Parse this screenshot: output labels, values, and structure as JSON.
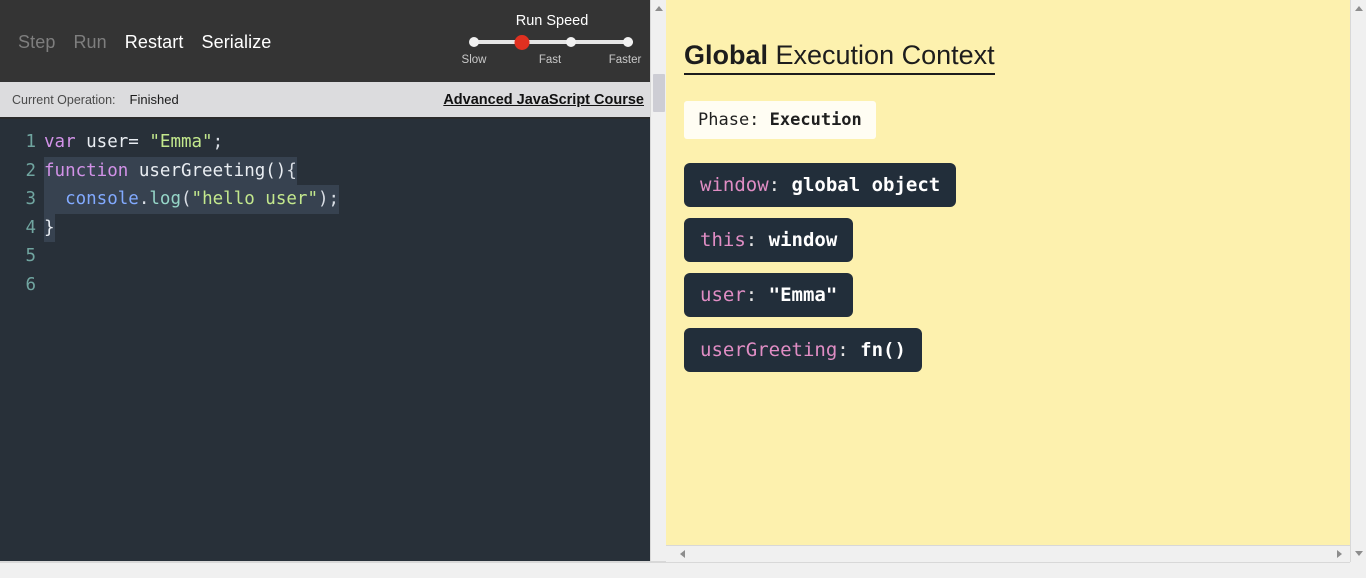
{
  "toolbar": {
    "buttons": [
      {
        "label": "Step",
        "enabled": false
      },
      {
        "label": "Run",
        "enabled": false
      },
      {
        "label": "Restart",
        "enabled": true
      },
      {
        "label": "Serialize",
        "enabled": true
      }
    ],
    "speed": {
      "title": "Run Speed",
      "ticks": [
        {
          "label": "Slow",
          "active": false
        },
        {
          "label": "",
          "active": true
        },
        {
          "label": "Fast",
          "active": false
        },
        {
          "label": "Faster",
          "active": false
        }
      ],
      "selected_index": 1
    }
  },
  "status": {
    "label": "Current Operation:",
    "value": "Finished",
    "course_link": "Advanced JavaScript Course"
  },
  "editor": {
    "lines": [
      {
        "number": "1",
        "text": "var user= \"Emma\";"
      },
      {
        "number": "2",
        "text": "function userGreeting(){"
      },
      {
        "number": "3",
        "text": "  console.log(\"hello user\");"
      },
      {
        "number": "4",
        "text": "}"
      },
      {
        "number": "5",
        "text": ""
      },
      {
        "number": "6",
        "text": ""
      }
    ],
    "tokens": {
      "l1_kw": "var",
      "l1_name": " user= ",
      "l1_str": "\"Emma\"",
      "l1_end": ";",
      "l2_kw": "function",
      "l2_name": " userGreeting()",
      "l2_brace": "{",
      "l3_indent": "  ",
      "l3_obj": "console",
      "l3_dot": ".",
      "l3_meth": "log",
      "l3_paren": "(",
      "l3_str": "\"hello user\"",
      "l3_end": ");",
      "l4_brace": "}"
    }
  },
  "context": {
    "title_bold": "Global",
    "title_rest": " Execution Context",
    "phase_label": "Phase: ",
    "phase_value": "Execution",
    "variables": [
      {
        "key": "window",
        "value": "global object"
      },
      {
        "key": "this",
        "value": "window"
      },
      {
        "key": "user",
        "value": "\"Emma\""
      },
      {
        "key": "userGreeting",
        "value": "fn()"
      }
    ]
  },
  "colors": {
    "toolbar_bg": "#343434",
    "editor_bg": "#283039",
    "panel_bg": "#fdf1ae",
    "var_box_bg": "#222e3a",
    "var_key": "#e08dc4",
    "slider_active": "#e03020",
    "status_bg": "#dcdcde"
  }
}
